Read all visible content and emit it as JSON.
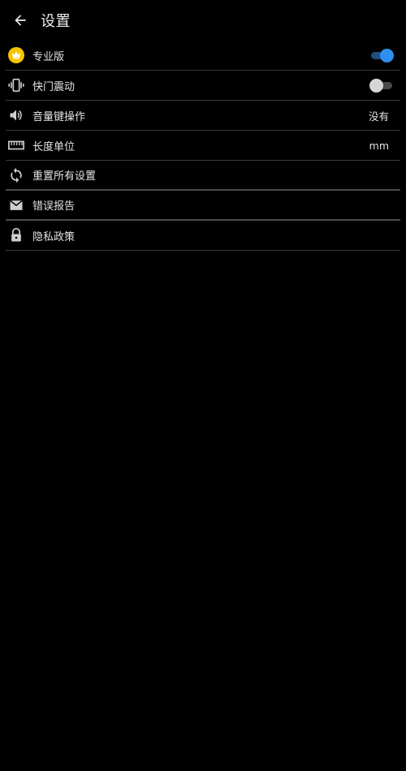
{
  "header": {
    "title": "设置",
    "back_icon": "arrow-left-icon"
  },
  "colors": {
    "background": "#000000",
    "text": "#e4e4e4",
    "divider": "#3a3a3a",
    "toggle_on_thumb": "#2f8ff0",
    "toggle_on_track": "#1e4f80",
    "toggle_off_thumb": "#d6d6d6",
    "toggle_off_track": "#4a4a4a",
    "crown_badge": "#f5c400"
  },
  "settings": {
    "items": [
      {
        "label": "专业版",
        "icon": "crown-icon",
        "toggle": "on"
      },
      {
        "label": "快门震动",
        "icon": "vibrate-icon",
        "toggle": "off"
      },
      {
        "label": "音量键操作",
        "icon": "volume-icon",
        "value": "没有"
      },
      {
        "label": "长度单位",
        "icon": "ruler-icon",
        "value": "mm"
      },
      {
        "label": "重置所有设置",
        "icon": "sync-icon"
      },
      {
        "label": "错误报告",
        "icon": "mail-icon"
      },
      {
        "label": "隐私政策",
        "icon": "lock-icon"
      }
    ]
  }
}
